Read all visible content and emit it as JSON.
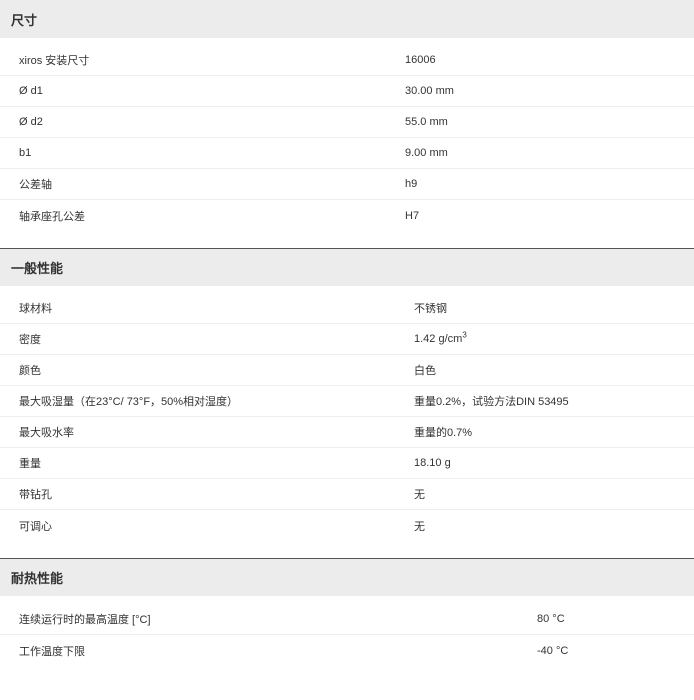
{
  "sections": [
    {
      "title": "尺寸",
      "rows": [
        {
          "label": "xiros 安装尺寸",
          "value": "16006"
        },
        {
          "label": "Ø d1",
          "value": "30.00 mm"
        },
        {
          "label": "Ø d2",
          "value": "55.0 mm"
        },
        {
          "label": "b1",
          "value": "9.00 mm"
        },
        {
          "label": "公差轴",
          "value": "h9"
        },
        {
          "label": "轴承座孔公差",
          "value": "H7"
        }
      ]
    },
    {
      "title": "一般性能",
      "rows": [
        {
          "label": "球材料",
          "value": "不锈钢"
        },
        {
          "label": "密度",
          "value": "1.42 g/cm",
          "value_sup": "3"
        },
        {
          "label": "颜色",
          "value": "白色"
        },
        {
          "label": "最大吸湿量（在23°C/ 73°F，50%相对湿度）",
          "value": "重量0.2%，试验方法DIN 53495"
        },
        {
          "label": "最大吸水率",
          "value": "重量的0.7%"
        },
        {
          "label": "重量",
          "value": "18.10 g"
        },
        {
          "label": "带钻孔",
          "value": "无"
        },
        {
          "label": "可调心",
          "value": "无"
        }
      ]
    },
    {
      "title": "耐热性能",
      "rows": [
        {
          "label": "连续运行时的最高温度 [°C]",
          "value": "80 °C"
        },
        {
          "label": "工作温度下限",
          "value": "-40 °C"
        }
      ]
    }
  ]
}
